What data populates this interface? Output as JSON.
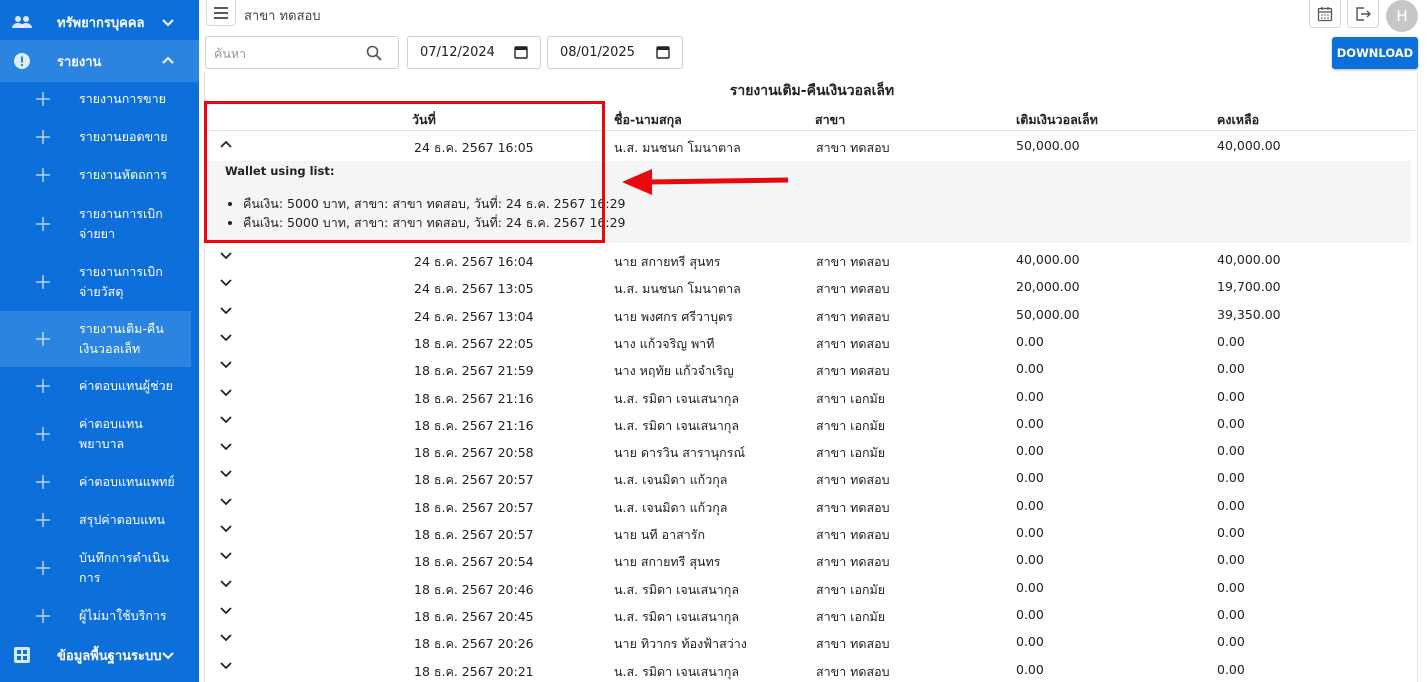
{
  "sidebar": {
    "groups": [
      {
        "label": "ทรัพยากรบุคคล",
        "icon": "people-icon"
      },
      {
        "label": "รายงาน",
        "icon": "alert-circle-icon"
      },
      {
        "label": "ข้อมูลพื้นฐานระบบ",
        "icon": "grid-icon"
      }
    ],
    "items": [
      {
        "label": "รายงานการขาย"
      },
      {
        "label": "รายงานยอดขาย"
      },
      {
        "label": "รายงานหัตถการ"
      },
      {
        "label": "รายงานการเบิกจ่ายยา"
      },
      {
        "label": "รายงานการเบิกจ่ายวัสดุ"
      },
      {
        "label": "รายงานเติม-คืนเงินวอลเล็ท"
      },
      {
        "label": "ค่าตอบแทนผู้ช่วย"
      },
      {
        "label": "ค่าตอบแทนพยาบาล"
      },
      {
        "label": "ค่าตอบแทนแพทย์"
      },
      {
        "label": "สรุปค่าตอบแทน"
      },
      {
        "label": "บันทึกการดำเนินการ"
      },
      {
        "label": "ผู้ไม่มาใช้บริการ"
      }
    ]
  },
  "topbar": {
    "breadcrumb": "สาขา ทดสอบ",
    "avatar_initial": "H",
    "icons": [
      "menu-icon",
      "calendar-icon",
      "logout-icon"
    ]
  },
  "filters": {
    "search_placeholder": "ค้นหา",
    "date_from": "07/12/2024",
    "date_to": "08/01/2025",
    "download_label": "DOWNLOAD"
  },
  "report": {
    "title": "รายงานเติม-คืนเงินวอลเล็ท",
    "columns": [
      "วันที่",
      "ชื่อ-นามสกุล",
      "สาขา",
      "เติมเงินวอลเล็ท",
      "คงเหลือ"
    ],
    "expanded": {
      "title": "Wallet using list:",
      "items": [
        "คืนเงิน: 5000 บาท, สาขา: สาขา ทดสอบ, วันที่: 24 ธ.ค. 2567 16:29",
        "คืนเงิน: 5000 บาท, สาขา: สาขา ทดสอบ, วันที่: 24 ธ.ค. 2567 16:29"
      ]
    },
    "rows": [
      {
        "date": "24 ธ.ค. 2567 16:05",
        "name": "น.ส. มนชนก โมนาตาล",
        "branch": "สาขา ทดสอบ",
        "topup": "50,000.00",
        "balance": "40,000.00"
      },
      {
        "date": "24 ธ.ค. 2567 16:04",
        "name": "นาย สกายทรี สุนทร",
        "branch": "สาขา ทดสอบ",
        "topup": "40,000.00",
        "balance": "40,000.00"
      },
      {
        "date": "24 ธ.ค. 2567 13:05",
        "name": "น.ส. มนชนก โมนาตาล",
        "branch": "สาขา ทดสอบ",
        "topup": "20,000.00",
        "balance": "19,700.00"
      },
      {
        "date": "24 ธ.ค. 2567 13:04",
        "name": "นาย พงศกร ศรีวาบุตร",
        "branch": "สาขา ทดสอบ",
        "topup": "50,000.00",
        "balance": "39,350.00"
      },
      {
        "date": "18 ธ.ค. 2567 22:05",
        "name": "นาง แก้วจริญ พาที",
        "branch": "สาขา ทดสอบ",
        "topup": "0.00",
        "balance": "0.00"
      },
      {
        "date": "18 ธ.ค. 2567 21:59",
        "name": "นาง หฤทัย แก้วจำเริญ",
        "branch": "สาขา ทดสอบ",
        "topup": "0.00",
        "balance": "0.00"
      },
      {
        "date": "18 ธ.ค. 2567 21:16",
        "name": "น.ส. รมิดา เจนเสนากุล",
        "branch": "สาขา เอกมัย",
        "topup": "0.00",
        "balance": "0.00"
      },
      {
        "date": "18 ธ.ค. 2567 21:16",
        "name": "น.ส. รมิดา เจนเสนากุล",
        "branch": "สาขา เอกมัย",
        "topup": "0.00",
        "balance": "0.00"
      },
      {
        "date": "18 ธ.ค. 2567 20:58",
        "name": "นาย ดารวิน สารานุกรณ์",
        "branch": "สาขา เอกมัย",
        "topup": "0.00",
        "balance": "0.00"
      },
      {
        "date": "18 ธ.ค. 2567 20:57",
        "name": "น.ส. เจนมิดา แก้วกุล",
        "branch": "สาขา ทดสอบ",
        "topup": "0.00",
        "balance": "0.00"
      },
      {
        "date": "18 ธ.ค. 2567 20:57",
        "name": "น.ส. เจนมิดา แก้วกุล",
        "branch": "สาขา ทดสอบ",
        "topup": "0.00",
        "balance": "0.00"
      },
      {
        "date": "18 ธ.ค. 2567 20:57",
        "name": "นาย นที อาสารัก",
        "branch": "สาขา ทดสอบ",
        "topup": "0.00",
        "balance": "0.00"
      },
      {
        "date": "18 ธ.ค. 2567 20:54",
        "name": "นาย สกายทรี สุนทร",
        "branch": "สาขา ทดสอบ",
        "topup": "0.00",
        "balance": "0.00"
      },
      {
        "date": "18 ธ.ค. 2567 20:46",
        "name": "น.ส. รมิดา เจนเสนากุล",
        "branch": "สาขา เอกมัย",
        "topup": "0.00",
        "balance": "0.00"
      },
      {
        "date": "18 ธ.ค. 2567 20:45",
        "name": "น.ส. รมิดา เจนเสนากุล",
        "branch": "สาขา เอกมัย",
        "topup": "0.00",
        "balance": "0.00"
      },
      {
        "date": "18 ธ.ค. 2567 20:26",
        "name": "นาย ทิวากร ท้องฟ้าสว่าง",
        "branch": "สาขา ทดสอบ",
        "topup": "0.00",
        "balance": "0.00"
      },
      {
        "date": "18 ธ.ค. 2567 20:21",
        "name": "น.ส. รมิดา เจนเสนากุล",
        "branch": "สาขา ทดสอบ",
        "topup": "0.00",
        "balance": "0.00"
      }
    ]
  },
  "colors": {
    "sidebar": "#0d6fd9",
    "sidebar_active": "#2b84e0",
    "annotation": "#e8090f"
  }
}
